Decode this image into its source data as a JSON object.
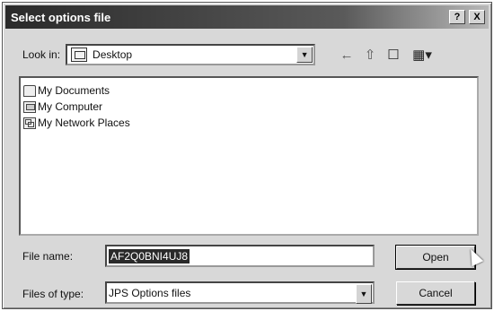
{
  "window": {
    "title": "Select options file",
    "help_btn": "?",
    "close_btn": "X"
  },
  "look_in": {
    "label": "Look in:",
    "value": "Desktop",
    "icons": [
      "back-arrow-icon",
      "up-folder-icon",
      "new-folder-icon",
      "view-menu-icon"
    ]
  },
  "files": [
    {
      "name": "My Documents",
      "icon": "documents-icon"
    },
    {
      "name": "My Computer",
      "icon": "computer-icon"
    },
    {
      "name": "My Network Places",
      "icon": "network-icon"
    }
  ],
  "file_name": {
    "label": "File name:",
    "value": "AF2Q0BNI4UJ8"
  },
  "file_type": {
    "label": "Files of type:",
    "value": "JPS Options files"
  },
  "buttons": {
    "open": "Open",
    "cancel": "Cancel"
  }
}
